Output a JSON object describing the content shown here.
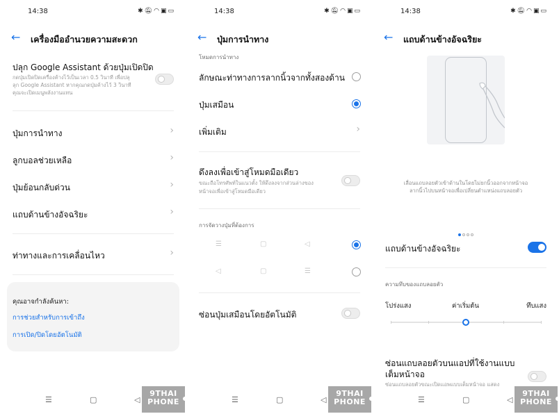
{
  "status": {
    "time": "14:38",
    "icons": [
      "bluetooth-icon",
      "mute-icon",
      "wifi-icon",
      "sim-icon",
      "battery-icon"
    ]
  },
  "colors": {
    "accent": "#1a73e8",
    "divider": "#ececec",
    "watermark": "#a7a7a7"
  },
  "watermark": {
    "line1": "9THAI",
    "line2": "PHONE"
  },
  "panel1": {
    "title": "เครื่องมืออำนวยความสะดวก",
    "assistant": {
      "label": "ปลุก Google Assistant ด้วยปุ่มเปิดปิด",
      "desc1": "กดปุ่มเปิดปิดเครื่องค้างไว้เป็นเวลา 0.5 วินาที เพื่อปลุ",
      "desc2": "ลุก Google Assistant หากคุณกดปุ่มค้างไว้ 3 วินาที",
      "desc3": "คุณจะเปิดเมนูพลังงานแทน",
      "enabled": false
    },
    "items": [
      {
        "label": "ปุ่มการนำทาง"
      },
      {
        "label": "ลูกบอลช่วยเหลือ"
      },
      {
        "label": "ปุ่มย้อนกลับด่วน"
      },
      {
        "label": "แถบด้านข้างอัจฉริยะ"
      },
      {
        "label": "ท่าทางและการเคลื่อนไหว"
      }
    ],
    "card": {
      "title": "คุณอาจกำลังค้นหา:",
      "links": [
        "การช่วยสำหรับการเข้าถึง",
        "การเปิด/ปิดโดยอัตโนมัติ"
      ]
    }
  },
  "panel2": {
    "title": "ปุ่มการนำทาง",
    "mode_section": "โหมดการนำทาง",
    "options": [
      {
        "label": "ลักษณะท่าทางการลากนิ้วจากทั้งสองด้าน",
        "selected": false
      },
      {
        "label": "ปุ่มเสมือน",
        "selected": true
      }
    ],
    "more": "เพิ่มเติม",
    "one_hand": {
      "label": "ดึงลงเพื่อเข้าสู่โหมดมือเดียว",
      "desc1": "ขณะถือโทรศัพท์ในแนวตั้ง ให้ดึงลงจากส่วนล่างของ",
      "desc2": "หน้าจอเพื่อเข้าสู่โหมดมือเดียว",
      "enabled": false
    },
    "layout_section": "การจัดวางปุ่มที่ต้องการ",
    "layouts": [
      {
        "keys": [
          "menu-icon",
          "home-icon",
          "back-icon"
        ],
        "selected": true
      },
      {
        "keys": [
          "back-icon",
          "home-icon",
          "menu-icon"
        ],
        "selected": false
      }
    ],
    "auto_hide": {
      "label": "ซ่อนปุ่มเสมือนโดยอัตโนมัติ",
      "enabled": false
    }
  },
  "panel3": {
    "title": "แถบด้านข้างอัจฉริยะ",
    "desc1": "เลื่อนแถบลอยตัวเข้าด้านในโดยไม่ยกนิ้วออกจากหน้าจอ",
    "desc2": "ลากนิ้วไปบนหน้าจอเพื่อเปลี่ยนตำแหน่งแถบลอยตัว",
    "page_indicator": {
      "current": 1,
      "total": 4
    },
    "toggle_label": "แถบด้านข้างอัจฉริยะ",
    "toggle_enabled": true,
    "opacity_section": "ความทึบของแถบลอยตัว",
    "opacity": {
      "left": "โปร่งแสง",
      "middle": "ค่าเริ่มต้น",
      "right": "ทึบแสง",
      "value": 0.5
    },
    "hide_fullscreen": {
      "label1": "ซ่อนแถบลอยตัวบนแอปที่ใช้งานแบบ",
      "label2": "เต็มหน้าจอ",
      "desc": "ซ่อนแถบลอยตัวขณะเปิดแอพแบบเต็มหน้าจอ แสดง",
      "enabled": false
    }
  }
}
